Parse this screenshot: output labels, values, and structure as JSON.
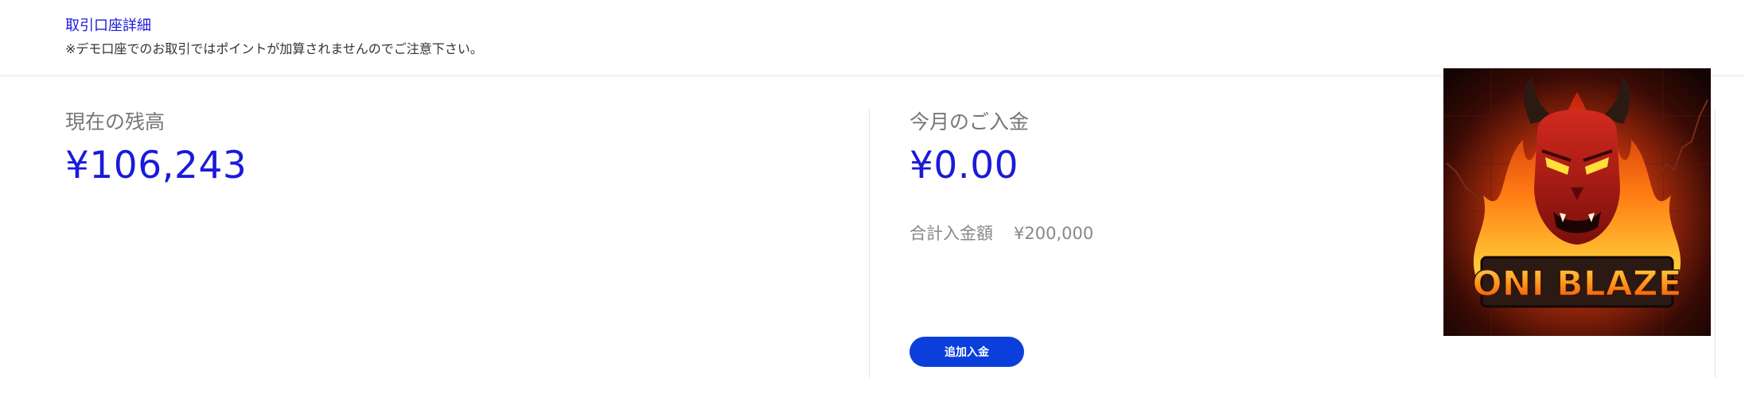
{
  "header": {
    "title_link": "取引口座詳細",
    "notice": "※デモ口座でのお取引ではポイントが加算されませんのでご注意下さい。"
  },
  "balance": {
    "label": "現在の残高",
    "value": "¥106,243"
  },
  "deposit": {
    "label": "今月のご入金",
    "value": "¥0.00",
    "total_label": "合計入金額",
    "total_value": "¥200,000",
    "add_button_label": "追加入金"
  },
  "logo": {
    "text": "ONI BLAZE",
    "icon": "oni-demon-mask-flame-icon"
  },
  "colors": {
    "accent": "#1a1adb",
    "button": "#0a3fdc",
    "muted_text": "#777777"
  }
}
